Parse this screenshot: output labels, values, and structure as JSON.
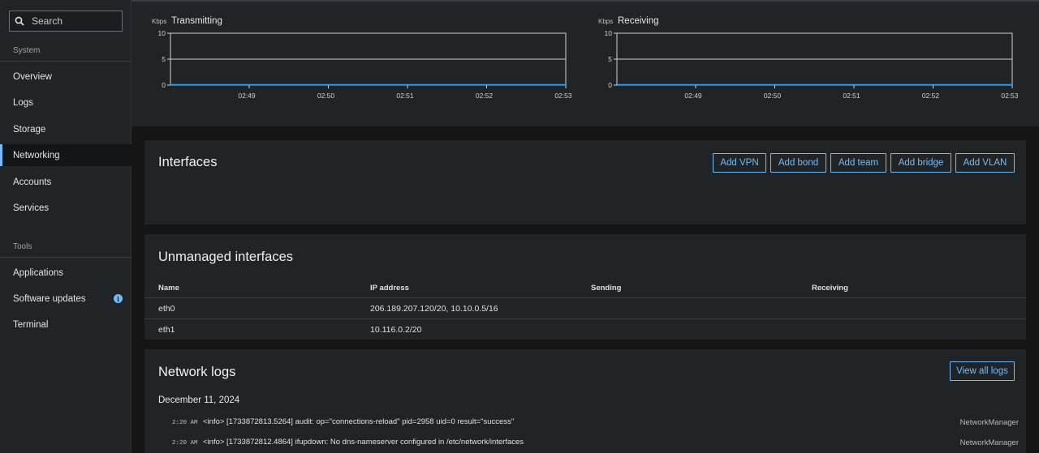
{
  "sidebar": {
    "search_label": "Search",
    "groups": [
      {
        "label": "System",
        "items": [
          "Overview",
          "Logs",
          "Storage",
          "Networking",
          "Accounts",
          "Services"
        ]
      },
      {
        "label": "Tools",
        "items": [
          "Applications",
          "Software updates",
          "Terminal"
        ]
      }
    ],
    "active_item": "Networking",
    "software_updates_badge": "i"
  },
  "charts": {
    "transmitting": {
      "unit": "Kbps",
      "title": "Transmitting"
    },
    "receiving": {
      "unit": "Kbps",
      "title": "Receiving"
    }
  },
  "chart_data": [
    {
      "type": "line",
      "title": "Transmitting",
      "ylabel": "Kbps",
      "ylim": [
        0,
        10
      ],
      "y_ticks": [
        "10",
        "5",
        "0"
      ],
      "x_ticks": [
        "02:49",
        "02:50",
        "02:51",
        "02:52",
        "02:53"
      ],
      "series": [
        {
          "values": [
            0,
            0,
            0,
            0,
            0,
            0
          ]
        }
      ],
      "grid": true,
      "line_color": "#2b9af3"
    },
    {
      "type": "line",
      "title": "Receiving",
      "ylabel": "Kbps",
      "ylim": [
        0,
        10
      ],
      "y_ticks": [
        "10",
        "5",
        "0"
      ],
      "x_ticks": [
        "02:49",
        "02:50",
        "02:51",
        "02:52",
        "02:53"
      ],
      "series": [
        {
          "values": [
            0,
            0,
            0,
            0,
            0,
            0
          ]
        }
      ],
      "grid": true,
      "line_color": "#2b9af3"
    }
  ],
  "interfaces": {
    "title": "Interfaces",
    "buttons": [
      "Add VPN",
      "Add bond",
      "Add team",
      "Add bridge",
      "Add VLAN"
    ]
  },
  "unmanaged": {
    "title": "Unmanaged interfaces",
    "columns": [
      "Name",
      "IP address",
      "Sending",
      "Receiving"
    ],
    "rows": [
      {
        "name": "eth0",
        "ip": "206.189.207.120/20, 10.10.0.5/16",
        "sending": "",
        "receiving": ""
      },
      {
        "name": "eth1",
        "ip": "10.116.0.2/20",
        "sending": "",
        "receiving": ""
      }
    ]
  },
  "network_logs": {
    "title": "Network logs",
    "view_all_label": "View all logs",
    "date": "December 11, 2024",
    "entries": [
      {
        "time": "2:20 AM",
        "message": "<info> [1733872813.5264] audit: op=\"connections-reload\" pid=2958 uid=0 result=\"success\"",
        "source": "NetworkManager"
      },
      {
        "time": "2:20 AM",
        "message": "<info> [1733872812.4864] ifupdown: No dns-nameserver configured in /etc/network/interfaces",
        "source": "NetworkManager"
      }
    ]
  },
  "colors": {
    "accent": "#73bcf7",
    "series": "#2b9af3"
  }
}
